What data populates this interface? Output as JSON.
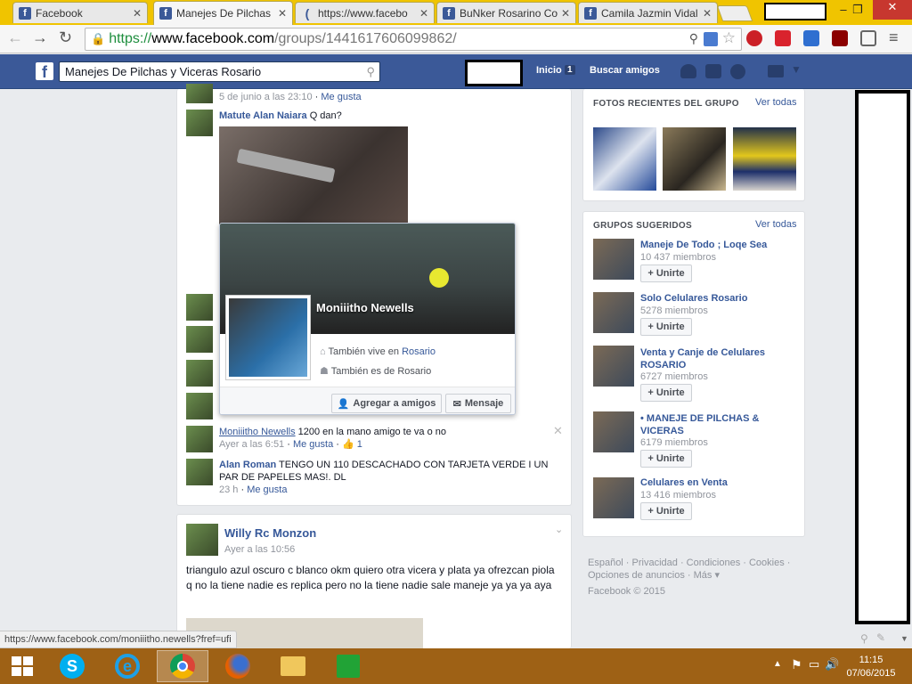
{
  "browser": {
    "tabs": [
      {
        "label": "Facebook",
        "icon": "f"
      },
      {
        "label": "Manejes De Pilchas",
        "icon": "f"
      },
      {
        "label": "https://www.facebo",
        "icon": "("
      },
      {
        "label": "BuNker Rosarino Co",
        "icon": "f"
      },
      {
        "label": "Camila Jazmin Vidal",
        "icon": "f"
      }
    ],
    "url_https": "https://",
    "url_domain": "www.facebook.com",
    "url_path": "/groups/1441617606099862/"
  },
  "fb": {
    "search_value": "Manejes De Pilchas y Viceras Rosario",
    "nav_home": "Inicio",
    "nav_home_badge": "1",
    "nav_find_friends": "Buscar amigos"
  },
  "feed": {
    "top_meta": "5 de junio a las 23:10",
    "like": "Me gusta",
    "comment1_author": "Matute Alan Naiara",
    "comment1_text": "Q dan?",
    "comment2_author": "Moniiitho Newells",
    "comment2_text": "1200 en la mano amigo te va o no",
    "comment2_time": "Ayer a las 6:51",
    "comment2_likes": "1",
    "comment3_author": "Alan Roman",
    "comment3_text": "TENGO UN 110 DESCACHADO CON TARJETA VERDE I UN PAR DE PAPELES MAS!. DL",
    "comment3_time": "23 h",
    "post2_author": "Willy Rc Monzon",
    "post2_time": "Ayer a las 10:56",
    "post2_text": "triangulo azul oscuro c blanco okm quiero otra vicera y plata ya ofrezcan piola q no la tiene nadie es replica pero no la tiene nadie sale maneje ya ya ya aya"
  },
  "hovercard": {
    "name": "Moniiitho Newells",
    "line1_prefix": "También vive en ",
    "line1_link": "Rosario",
    "line2": "También es de Rosario",
    "add_friend": "Agregar a amigos",
    "message": "Mensaje"
  },
  "sidebar": {
    "photos_title": "FOTOS RECIENTES DEL GRUPO",
    "see_all": "Ver todas",
    "groups_title": "GRUPOS SUGERIDOS",
    "join": "Unirte",
    "groups": [
      {
        "name": "Maneje De Todo ; Loqe Sea",
        "members": "10 437 miembros"
      },
      {
        "name": "Solo Celulares Rosario",
        "members": "5278 miembros"
      },
      {
        "name": "Venta y Canje de Celulares ROSARIO",
        "members": "6727 miembros"
      },
      {
        "name": "• MANEJE DE PILCHAS & VICERAS",
        "members": "6179 miembros"
      },
      {
        "name": "Celulares en Venta",
        "members": "13 416 miembros"
      }
    ],
    "footer_line1": "Español · Privacidad · Condiciones · Cookies ·",
    "footer_line2": "Opciones de anuncios · Más ▾",
    "copyright": "Facebook © 2015"
  },
  "statusbar": {
    "url": "https://www.facebook.com/moniiitho.newells?fref=ufi"
  },
  "taskbar": {
    "time": "11:15",
    "date": "07/06/2015"
  }
}
